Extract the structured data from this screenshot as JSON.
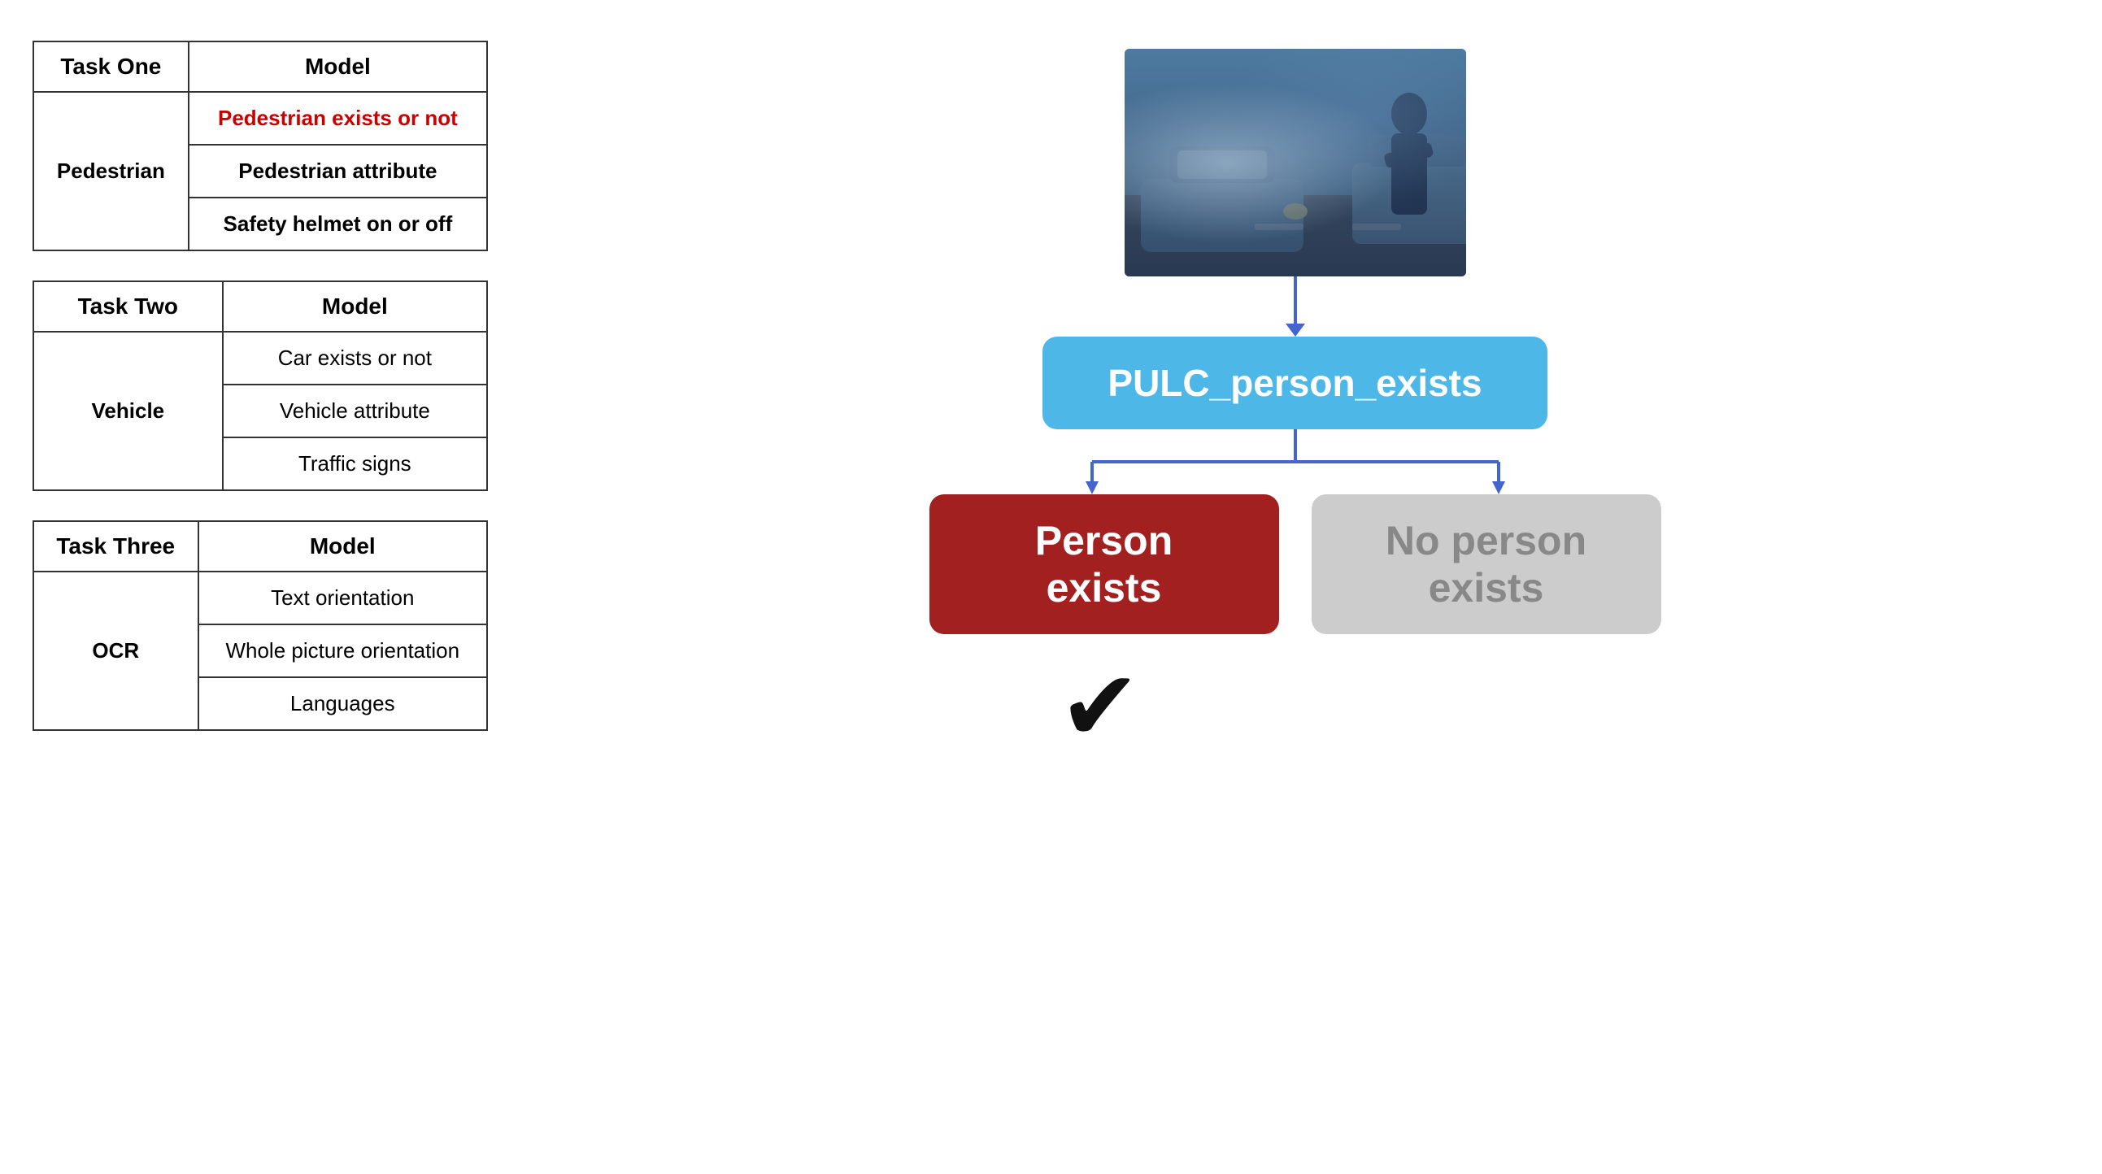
{
  "tables": {
    "task_one": {
      "task_label": "Task One",
      "model_label": "Model",
      "category": "Pedestrian",
      "rows": [
        {
          "model": "Pedestrian exists or not",
          "highlight": true
        },
        {
          "model": "Pedestrian attribute",
          "highlight": false
        },
        {
          "model": "Safety helmet on or off",
          "highlight": false
        }
      ]
    },
    "task_two": {
      "task_label": "Task Two",
      "model_label": "Model",
      "category": "Vehicle",
      "rows": [
        {
          "model": "Car exists or not"
        },
        {
          "model": "Vehicle attribute"
        },
        {
          "model": "Traffic signs"
        }
      ]
    },
    "task_three": {
      "task_label": "Task Three",
      "model_label": "Model",
      "category": "OCR",
      "rows": [
        {
          "model": "Text orientation"
        },
        {
          "model": "Whole picture orientation"
        },
        {
          "model": "Languages"
        }
      ]
    }
  },
  "diagram": {
    "pulc_label": "PULC_person_exists",
    "person_exists_label": "Person exists",
    "no_person_label": "No person exists",
    "checkmark": "✔"
  },
  "colors": {
    "pulc_bg": "#4db8e8",
    "person_exists_bg": "#a32020",
    "no_person_bg": "#cccccc",
    "arrow_color": "#4466cc",
    "red_text": "#cc0000"
  }
}
